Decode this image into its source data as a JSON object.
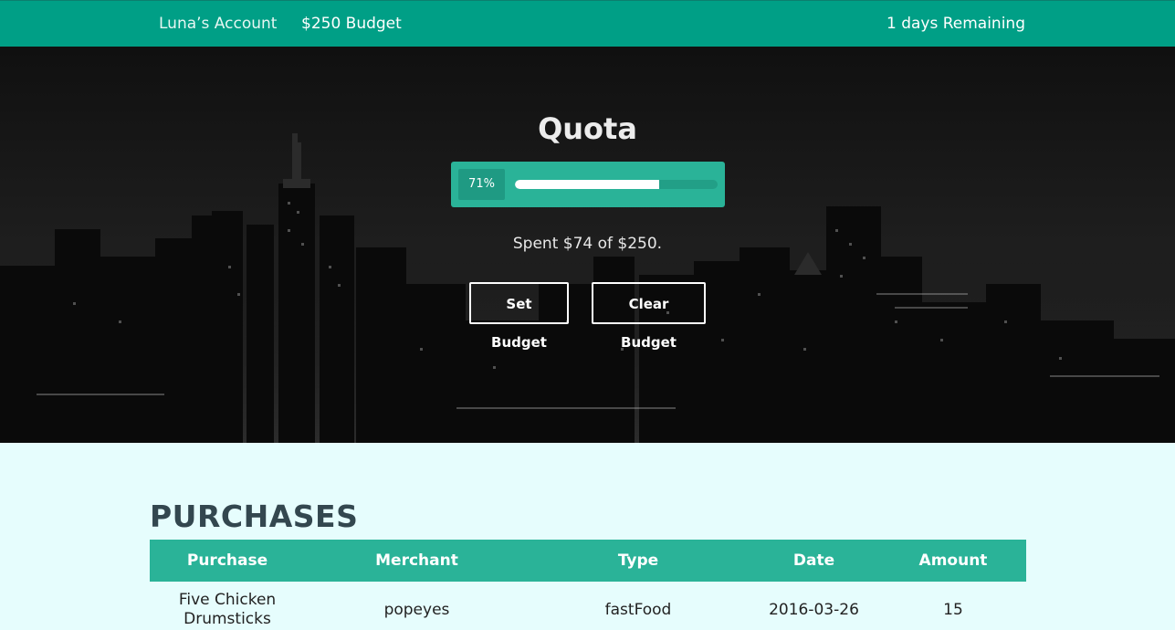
{
  "topbar": {
    "account": "Luna’s Account",
    "budget": "$250 Budget",
    "remaining": "1 days Remaining"
  },
  "hero": {
    "title": "Quota",
    "progress_percent": 71,
    "progress_label": "71%",
    "spent_text": "Spent $74 of $250.",
    "set_budget_label": "Set Budget",
    "clear_budget_label": "Clear Budget"
  },
  "purchases": {
    "title": "PURCHASES",
    "columns": [
      "Purchase",
      "Merchant",
      "Type",
      "Date",
      "Amount"
    ],
    "rows": [
      {
        "purchase": "Five Chicken Drumsticks",
        "merchant": "popeyes",
        "type": "fastFood",
        "date": "2016-03-26",
        "amount": "15"
      }
    ]
  },
  "colors": {
    "topbar": "#009f86",
    "accent": "#2ab398",
    "page_background": "#e6fdfd",
    "heading_text": "#33474f"
  }
}
